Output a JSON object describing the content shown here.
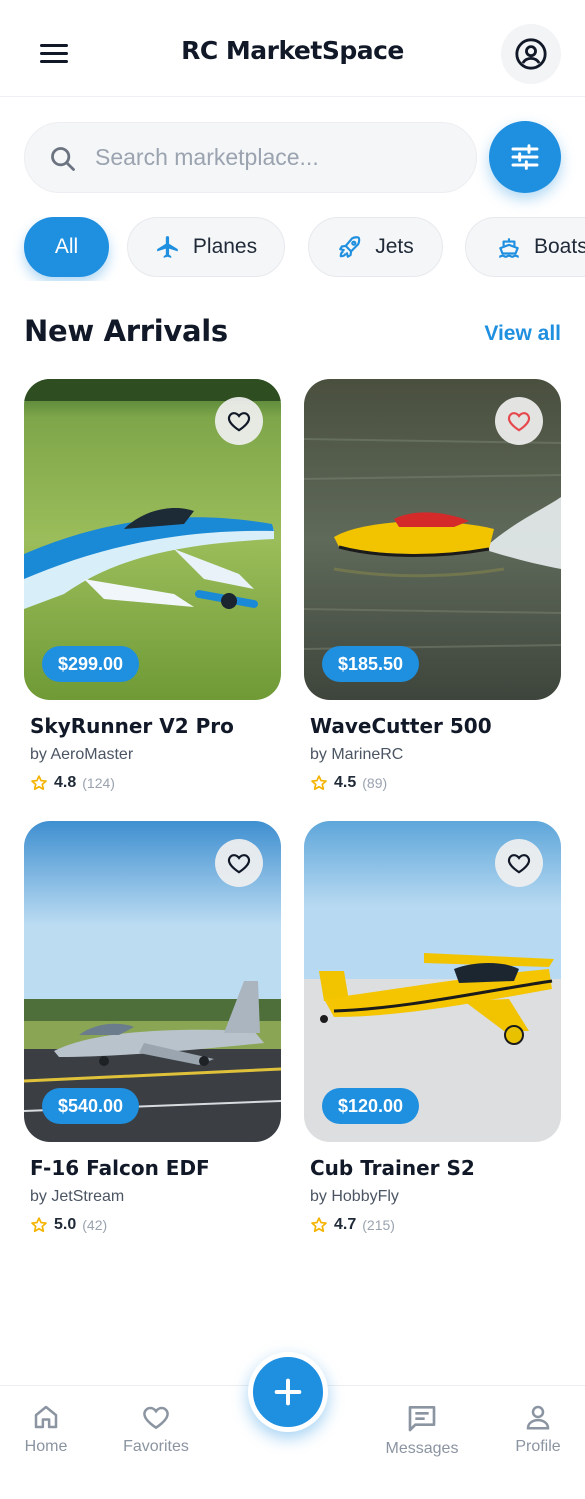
{
  "header": {
    "title": "RC MarketSpace",
    "menu_icon": "menu-icon",
    "profile_icon": "user-circle-icon"
  },
  "search": {
    "placeholder": "Search marketplace...",
    "value": ""
  },
  "categories": [
    {
      "label": "All",
      "active": true,
      "icon": ""
    },
    {
      "label": "Planes",
      "active": false,
      "icon": "plane-icon"
    },
    {
      "label": "Jets",
      "active": false,
      "icon": "rocket-icon"
    },
    {
      "label": "Boats",
      "active": false,
      "icon": "boat-icon"
    }
  ],
  "section": {
    "title": "New Arrivals",
    "view_all": "View all"
  },
  "products": [
    {
      "name": "SkyRunner V2 Pro",
      "by": "by AeroMaster",
      "price": "$299.00",
      "rating": "4.8",
      "reviews": "(124)",
      "favorited": false
    },
    {
      "name": "WaveCutter 500",
      "by": "by MarineRC",
      "price": "$185.50",
      "rating": "4.5",
      "reviews": "(89)",
      "favorited": true
    },
    {
      "name": "F-16 Falcon EDF",
      "by": "by JetStream",
      "price": "$540.00",
      "rating": "5.0",
      "reviews": "(42)",
      "favorited": false
    },
    {
      "name": "Cub Trainer S2",
      "by": "by HobbyFly",
      "price": "$120.00",
      "rating": "4.7",
      "reviews": "(215)",
      "favorited": false
    }
  ],
  "nav": {
    "home": "Home",
    "favorites": "Favorites",
    "messages": "Messages",
    "profile": "Profile"
  },
  "colors": {
    "accent": "#1f8fe0",
    "star": "#f5b301",
    "favorite_active": "#e5484d"
  }
}
